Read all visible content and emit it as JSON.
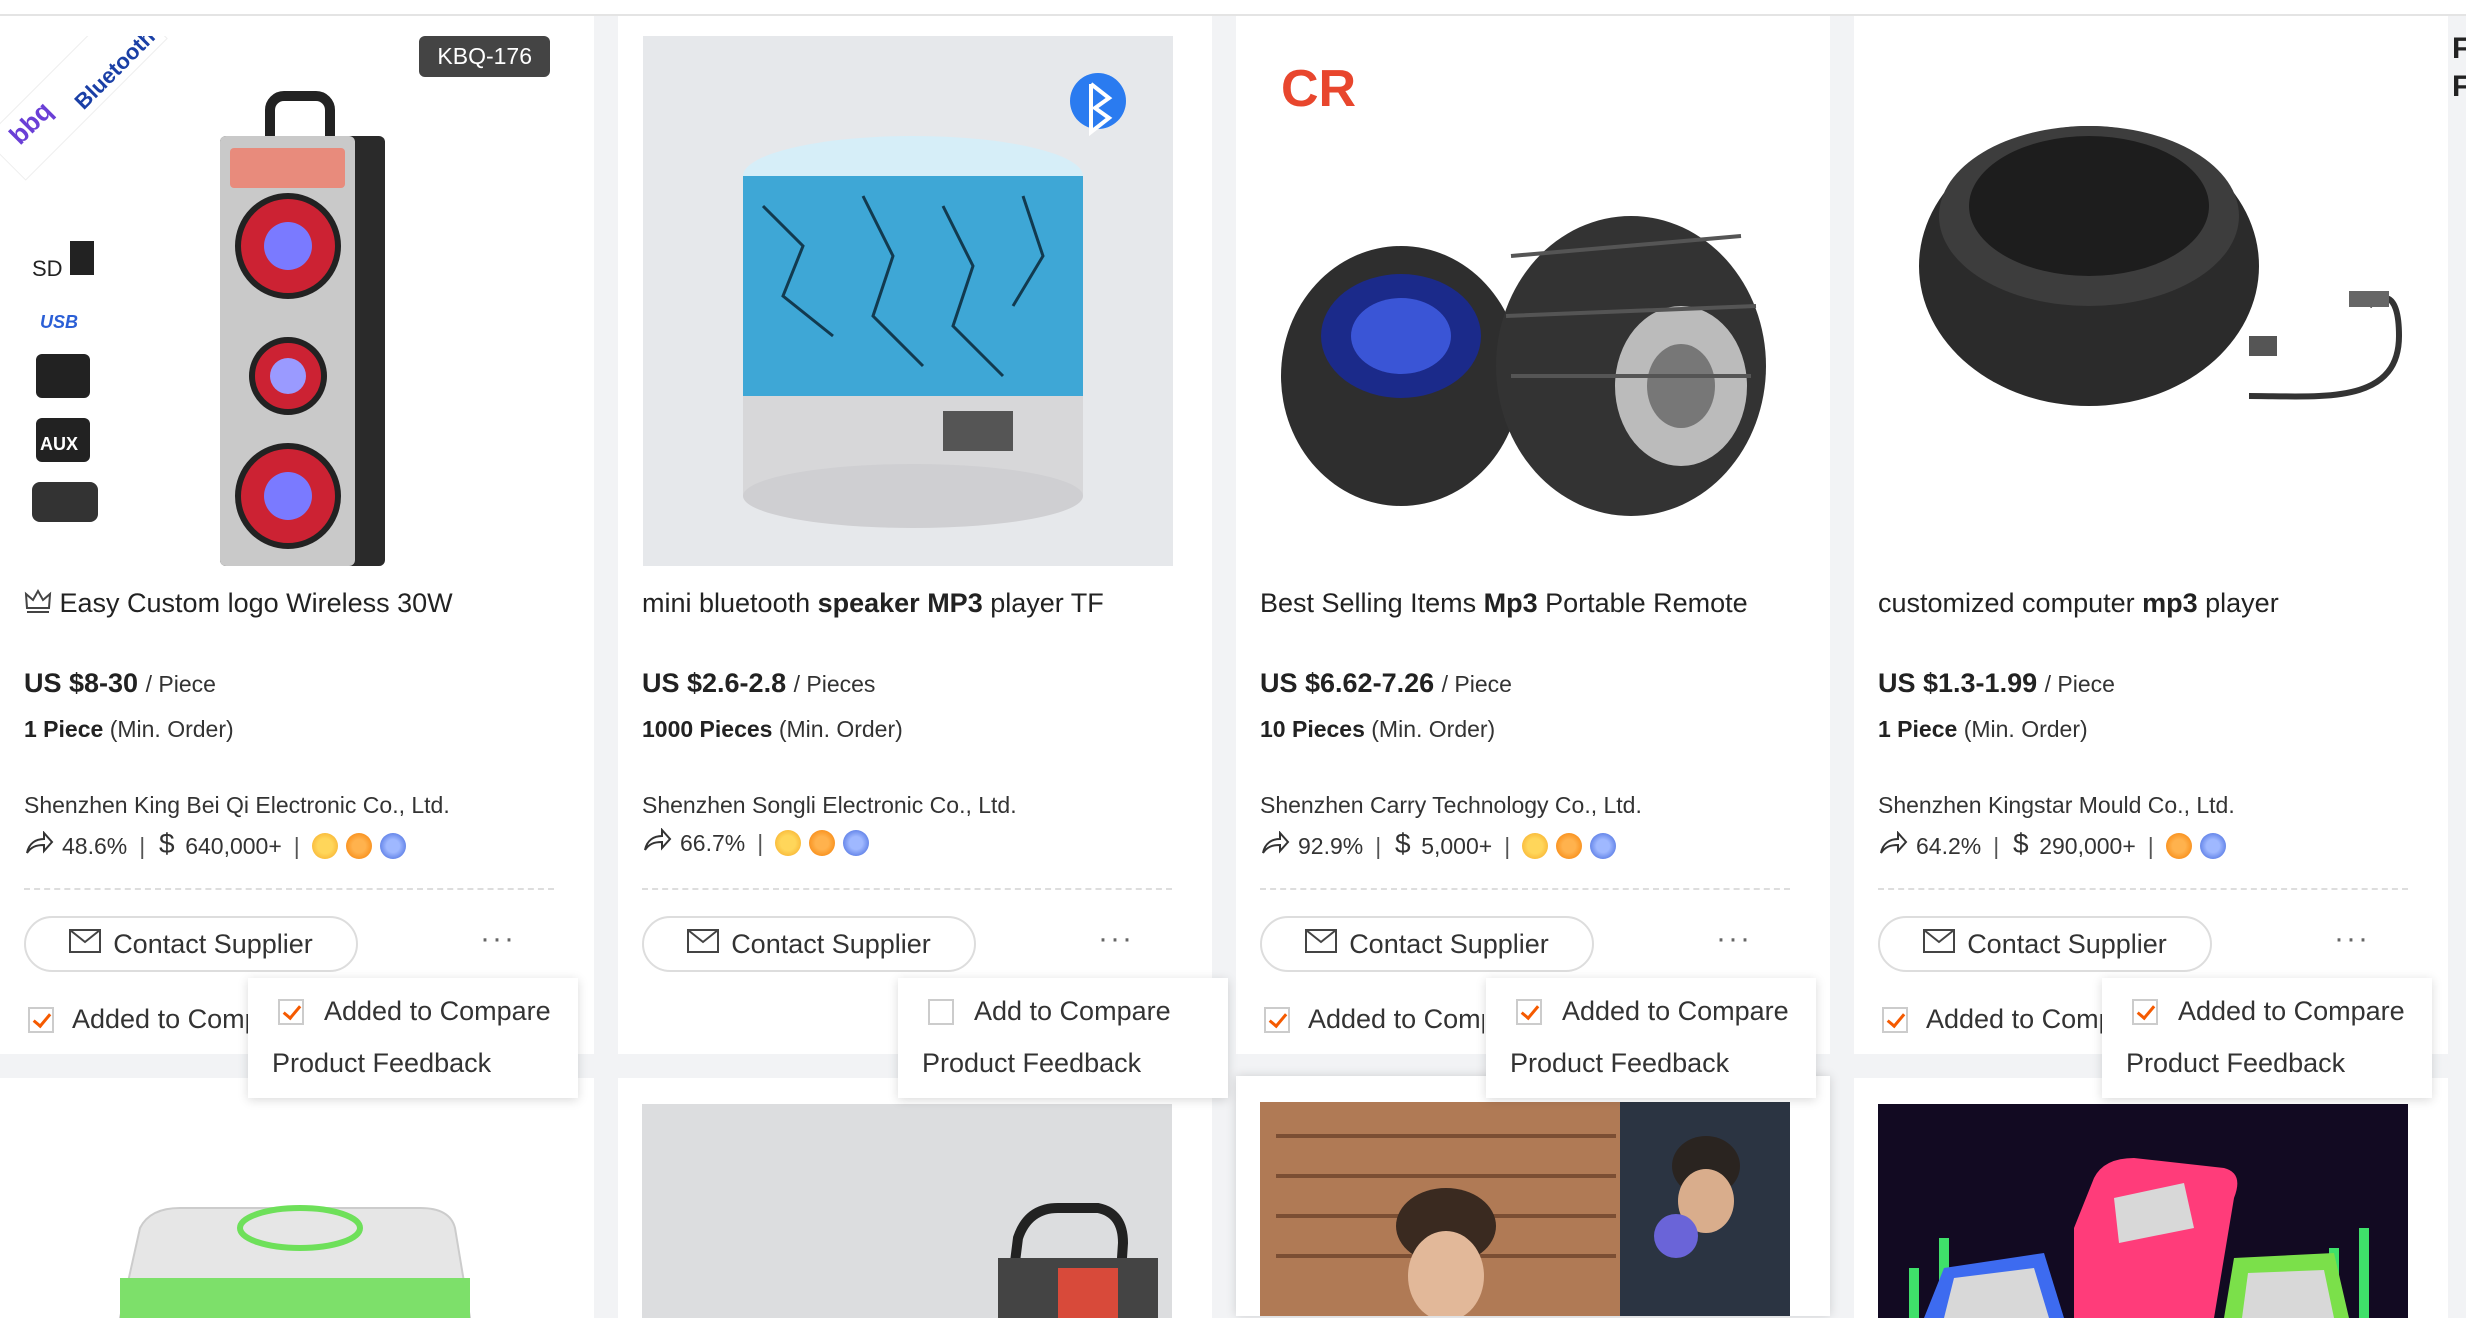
{
  "right_edge": {
    "line1": "F",
    "line2": "F"
  },
  "contact_label": "Contact Supplier",
  "added_to_compare_label": "Added to Compare",
  "add_to_compare_label": "Add to Compare",
  "product_feedback_label": "Product Feedback",
  "products": [
    {
      "sku_badge": "KBQ-176",
      "title": "Easy Custom logo Wireless 30W",
      "price": "US $8-30",
      "price_unit": "/ Piece",
      "moq_qty": "1 Piece",
      "moq_label": "(Min. Order)",
      "supplier": "Shenzhen King Bei Qi Electronic Co., Ltd.",
      "response_rate": "48.6%",
      "revenue": "640,000+",
      "compare_checked": true,
      "menu_compare_checked": true
    },
    {
      "title_pre": "mini bluetooth ",
      "title_bold": "speaker MP3",
      "title_post": " player TF",
      "price": "US $2.6-2.8",
      "price_unit": "/ Pieces",
      "moq_qty": "1000 Pieces",
      "moq_label": "(Min. Order)",
      "supplier": "Shenzhen Songli Electronic Co., Ltd.",
      "response_rate": "66.7%",
      "menu_compare_checked": false
    },
    {
      "brand_logo": "CR",
      "title_pre": "Best Selling Items ",
      "title_bold": "Mp3",
      "title_post": " Portable Remote",
      "price": "US $6.62-7.26",
      "price_unit": "/ Piece",
      "moq_qty": "10 Pieces",
      "moq_label": "(Min. Order)",
      "supplier": "Shenzhen Carry Technology Co., Ltd.",
      "response_rate": "92.9%",
      "revenue": "5,000+",
      "compare_checked": true,
      "menu_compare_checked": true
    },
    {
      "title_pre": "customized computer ",
      "title_bold": "mp3",
      "title_post": " player",
      "price": "US $1.3-1.99",
      "price_unit": "/ Piece",
      "moq_qty": "1 Piece",
      "moq_label": "(Min. Order)",
      "supplier": "Shenzhen Kingstar Mould Co., Ltd.",
      "response_rate": "64.2%",
      "revenue": "290,000+",
      "compare_checked": true,
      "menu_compare_checked": true
    }
  ]
}
